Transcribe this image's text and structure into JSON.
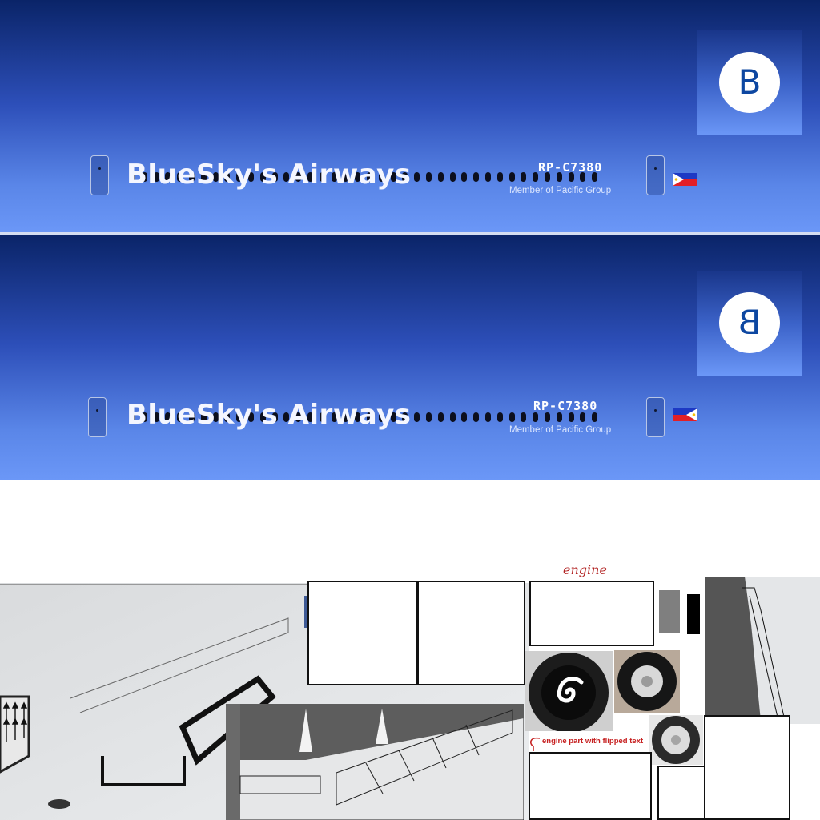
{
  "livery": {
    "airline_name": "BlueSky's Airways",
    "registration": "RP-C7380",
    "member_text": "Member of Pacific Group",
    "logo_letter": "B",
    "colors": {
      "fuselage_top": "#0a2468",
      "fuselage_bottom": "#6b97f7",
      "logo_text": "#0d47a1"
    }
  },
  "annotations": {
    "engine_label": "engine",
    "engine_part_label": "engine part with flipped text"
  },
  "icons": {
    "flag": "philippines-flag-icon",
    "logo": "b-circle-logo-icon",
    "engine_spinner": "spiral-spinner-icon",
    "wheel": "wheel-icon"
  }
}
